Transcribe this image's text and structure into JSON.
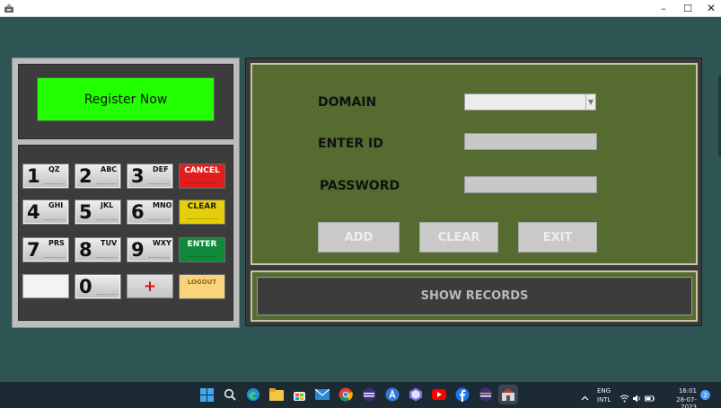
{
  "window": {
    "minimize_glyph": "–",
    "maximize_glyph": "☐",
    "close_glyph": "✕"
  },
  "register": {
    "label": "Register Now",
    "color": "#22ff00"
  },
  "keypad": {
    "keys": [
      {
        "num": "1",
        "sub": "QZ"
      },
      {
        "num": "2",
        "sub": "ABC"
      },
      {
        "num": "3",
        "sub": "DEF"
      },
      {
        "num": "4",
        "sub": "GHI"
      },
      {
        "num": "5",
        "sub": "JKL"
      },
      {
        "num": "6",
        "sub": "MNO"
      },
      {
        "num": "7",
        "sub": "PRS"
      },
      {
        "num": "8",
        "sub": "TUV"
      },
      {
        "num": "9",
        "sub": "WXY"
      },
      {
        "num": "0",
        "sub": ""
      }
    ],
    "cancel": "CANCEL",
    "clear": "CLEAR",
    "enter": "ENTER",
    "logout": "LOGOUT",
    "plus": "+"
  },
  "form": {
    "domain_label": "DOMAIN",
    "domain_value": "",
    "enter_id_label": "ENTER ID",
    "enter_id_value": "",
    "password_label": "PASSWORD",
    "password_value": ""
  },
  "buttons": {
    "add": "ADD",
    "clear": "CLEAR",
    "exit": "EXIT",
    "show_records": "SHOW RECORDS"
  },
  "taskbar": {
    "lang_line1": "ENG",
    "lang_line2": "INTL",
    "time": "16:01",
    "date": "28-07-2023",
    "notification_count": "2"
  },
  "colors": {
    "background": "#2f5454",
    "form_panel": "#556b2f",
    "cancel_key": "#e21d1d",
    "clear_key": "#e5cf0a",
    "enter_key": "#0f8a3b",
    "logout_key": "#fbd37a"
  }
}
